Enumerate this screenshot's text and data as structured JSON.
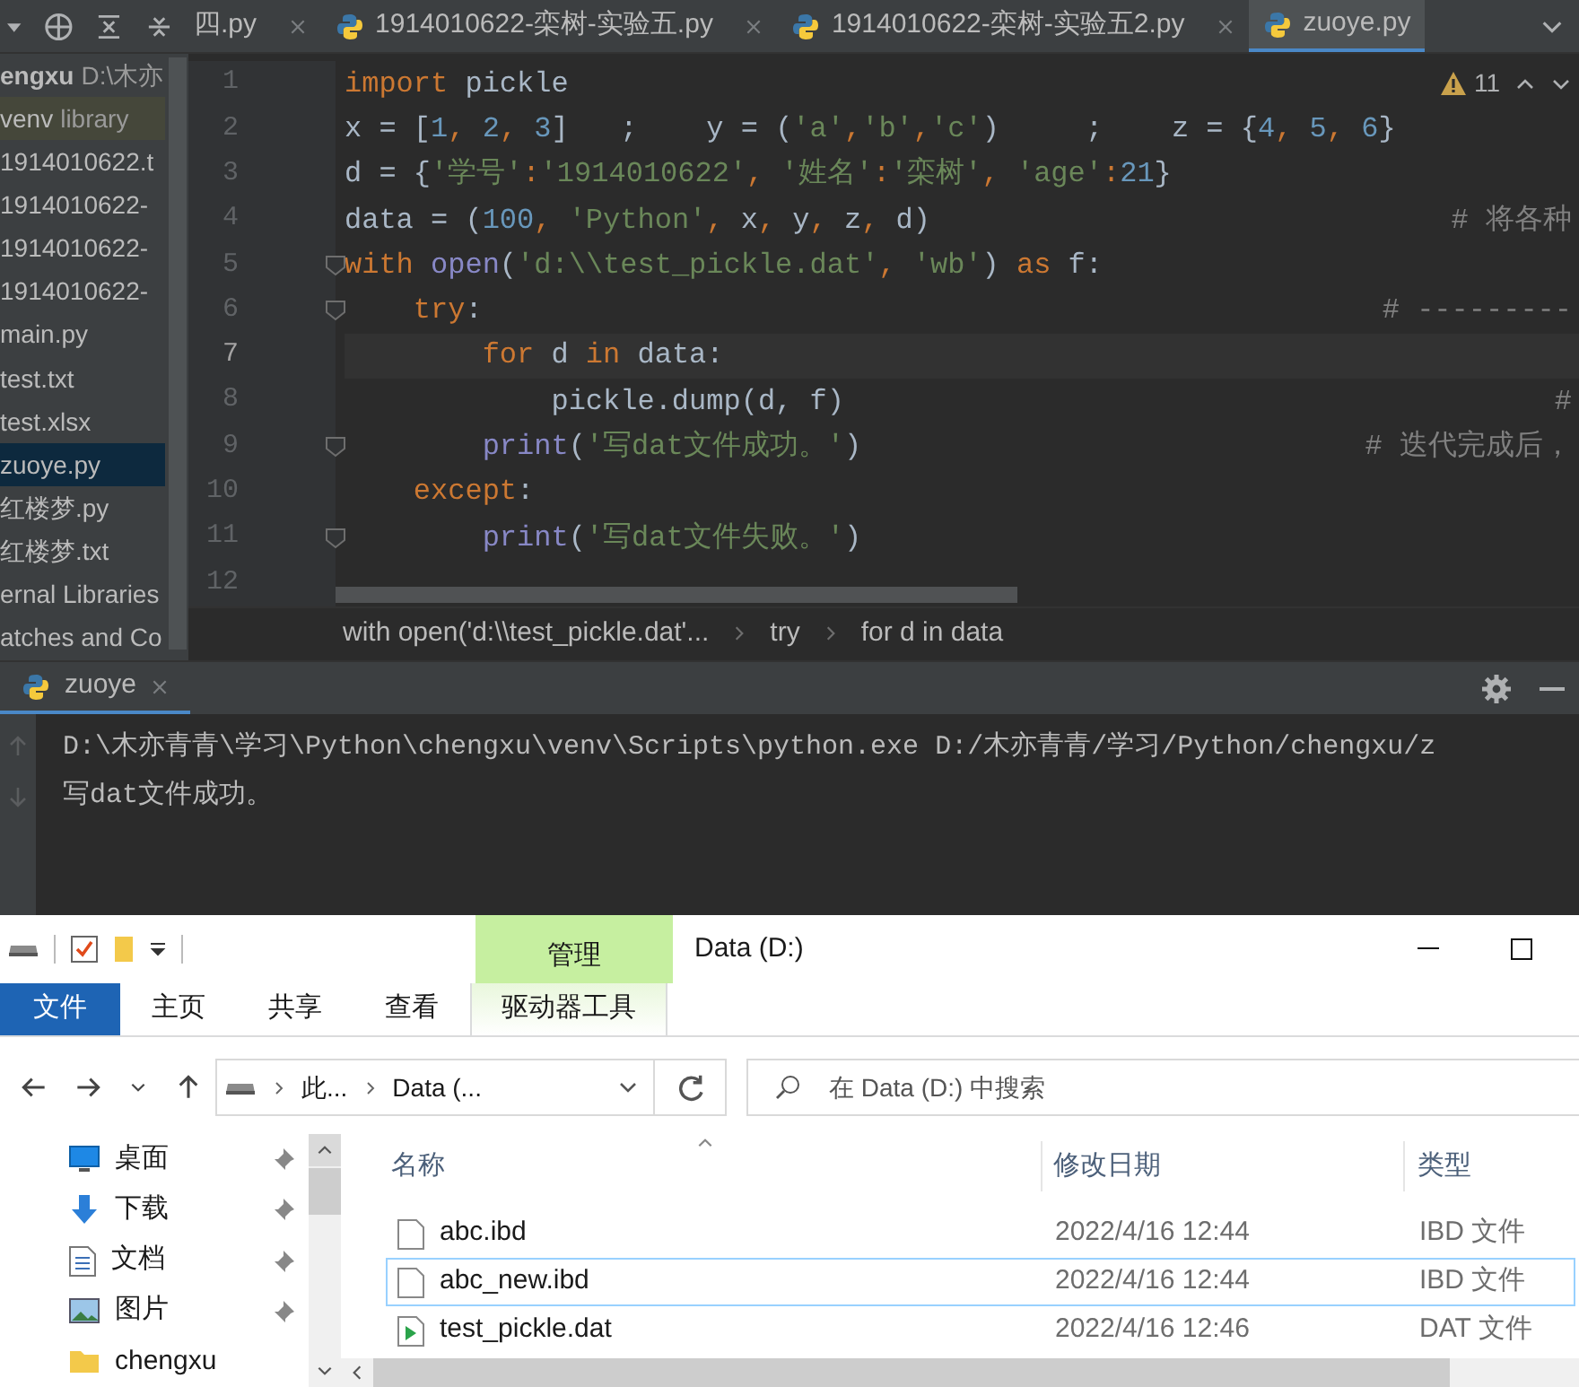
{
  "ide": {
    "tabs": [
      {
        "label": "四.py",
        "selected": false
      },
      {
        "label": "1914010622-栾树-实验五.py",
        "selected": false
      },
      {
        "label": "1914010622-栾树-实验五2.py",
        "selected": false
      },
      {
        "label": "zuoye.py",
        "selected": true
      }
    ],
    "project": {
      "items": [
        {
          "name": "engxu",
          "hint": "D:\\木亦",
          "selected": false,
          "kind": "root"
        },
        {
          "name": "venv",
          "hint": "library",
          "selected": false,
          "kind": "folder"
        },
        {
          "name": "1914010622.t",
          "selected": false,
          "kind": "file"
        },
        {
          "name": "1914010622-",
          "selected": false,
          "kind": "file"
        },
        {
          "name": "1914010622-",
          "selected": false,
          "kind": "file"
        },
        {
          "name": "1914010622-",
          "selected": false,
          "kind": "file"
        },
        {
          "name": "main.py",
          "selected": false,
          "kind": "file"
        },
        {
          "name": "test.txt",
          "selected": false,
          "kind": "file"
        },
        {
          "name": "test.xlsx",
          "selected": false,
          "kind": "file"
        },
        {
          "name": "zuoye.py",
          "selected": true,
          "kind": "file"
        },
        {
          "name": "红楼梦.py",
          "selected": false,
          "kind": "file"
        },
        {
          "name": "红楼梦.txt",
          "selected": false,
          "kind": "file"
        },
        {
          "name": "ernal Libraries",
          "selected": false,
          "kind": "file"
        },
        {
          "name": "atches and Co",
          "selected": false,
          "kind": "file"
        }
      ]
    },
    "editor": {
      "warnings": "11",
      "lines": [
        {
          "number": "1",
          "current": false,
          "fold": false,
          "tokens": [
            {
              "text": "import",
              "kind": "keyword"
            },
            {
              "text": " pickle",
              "kind": "plain"
            }
          ]
        },
        {
          "number": "2",
          "current": false,
          "fold": false,
          "tokens": [
            {
              "text": "x = [",
              "kind": "plain"
            },
            {
              "text": "1",
              "kind": "number"
            },
            {
              "text": ", ",
              "kind": "keyword"
            },
            {
              "text": "2",
              "kind": "number"
            },
            {
              "text": ", ",
              "kind": "keyword"
            },
            {
              "text": "3",
              "kind": "number"
            },
            {
              "text": "]   ;    y = (",
              "kind": "plain"
            },
            {
              "text": "'a'",
              "kind": "string"
            },
            {
              "text": ",",
              "kind": "keyword"
            },
            {
              "text": "'b'",
              "kind": "string"
            },
            {
              "text": ",",
              "kind": "keyword"
            },
            {
              "text": "'c'",
              "kind": "string"
            },
            {
              "text": ")     ;    z = {",
              "kind": "plain"
            },
            {
              "text": "4",
              "kind": "number"
            },
            {
              "text": ", ",
              "kind": "keyword"
            },
            {
              "text": "5",
              "kind": "number"
            },
            {
              "text": ", ",
              "kind": "keyword"
            },
            {
              "text": "6",
              "kind": "number"
            },
            {
              "text": "}",
              "kind": "plain"
            }
          ]
        },
        {
          "number": "3",
          "current": false,
          "fold": false,
          "tokens": [
            {
              "text": "d = {",
              "kind": "plain"
            },
            {
              "text": "'学号'",
              "kind": "string"
            },
            {
              "text": ":",
              "kind": "keyword"
            },
            {
              "text": "'1914010622'",
              "kind": "string"
            },
            {
              "text": ", ",
              "kind": "keyword"
            },
            {
              "text": "'姓名'",
              "kind": "string"
            },
            {
              "text": ":",
              "kind": "keyword"
            },
            {
              "text": "'栾树'",
              "kind": "string"
            },
            {
              "text": ", ",
              "kind": "keyword"
            },
            {
              "text": "'age'",
              "kind": "string"
            },
            {
              "text": ":",
              "kind": "keyword"
            },
            {
              "text": "21",
              "kind": "number"
            },
            {
              "text": "}",
              "kind": "plain"
            }
          ]
        },
        {
          "number": "4",
          "current": false,
          "fold": false,
          "comment": "# 将各种",
          "tokens": [
            {
              "text": "data = (",
              "kind": "plain"
            },
            {
              "text": "100",
              "kind": "number"
            },
            {
              "text": ", ",
              "kind": "keyword"
            },
            {
              "text": "'Python'",
              "kind": "string"
            },
            {
              "text": ", ",
              "kind": "keyword"
            },
            {
              "text": "x",
              "kind": "plain"
            },
            {
              "text": ", ",
              "kind": "keyword"
            },
            {
              "text": "y",
              "kind": "plain"
            },
            {
              "text": ", ",
              "kind": "keyword"
            },
            {
              "text": "z",
              "kind": "plain"
            },
            {
              "text": ", ",
              "kind": "keyword"
            },
            {
              "text": "d)",
              "kind": "plain"
            }
          ]
        },
        {
          "number": "5",
          "current": false,
          "fold": true,
          "tokens": [
            {
              "text": "with ",
              "kind": "keyword"
            },
            {
              "text": "open",
              "kind": "builtin"
            },
            {
              "text": "(",
              "kind": "plain"
            },
            {
              "text": "'d:\\\\test_pickle.dat'",
              "kind": "string"
            },
            {
              "text": ", ",
              "kind": "keyword"
            },
            {
              "text": "'wb'",
              "kind": "string"
            },
            {
              "text": ") ",
              "kind": "plain"
            },
            {
              "text": "as ",
              "kind": "keyword"
            },
            {
              "text": "f:",
              "kind": "plain"
            }
          ]
        },
        {
          "number": "6",
          "current": false,
          "fold": true,
          "comment": "# ---------",
          "tokens": [
            {
              "text": "    try",
              "kind": "keyword"
            },
            {
              "text": ":",
              "kind": "plain"
            }
          ]
        },
        {
          "number": "7",
          "current": true,
          "fold": false,
          "tokens": [
            {
              "text": "        for ",
              "kind": "keyword"
            },
            {
              "text": "d ",
              "kind": "plain"
            },
            {
              "text": "in ",
              "kind": "keyword"
            },
            {
              "text": "data:",
              "kind": "plain"
            }
          ]
        },
        {
          "number": "8",
          "current": false,
          "fold": false,
          "comment": "#",
          "tokens": [
            {
              "text": "            pickle.dump(d, f)",
              "kind": "plain"
            }
          ]
        },
        {
          "number": "9",
          "current": false,
          "fold": true,
          "comment": "# 迭代完成后，",
          "tokens": [
            {
              "text": "        print",
              "kind": "builtin"
            },
            {
              "text": "(",
              "kind": "plain"
            },
            {
              "text": "'写dat文件成功。'",
              "kind": "string"
            },
            {
              "text": ")",
              "kind": "plain"
            }
          ]
        },
        {
          "number": "10",
          "current": false,
          "fold": false,
          "tokens": [
            {
              "text": "    except",
              "kind": "keyword"
            },
            {
              "text": ":",
              "kind": "plain"
            }
          ]
        },
        {
          "number": "11",
          "current": false,
          "fold": true,
          "tokens": [
            {
              "text": "        print",
              "kind": "builtin"
            },
            {
              "text": "(",
              "kind": "plain"
            },
            {
              "text": "'写dat文件失败。'",
              "kind": "string"
            },
            {
              "text": ")",
              "kind": "plain"
            }
          ]
        },
        {
          "number": "12",
          "current": false,
          "fold": false
        }
      ],
      "breadcrumbs": [
        "with open('d:\\\\test_pickle.dat'...",
        "try",
        "for d in data"
      ]
    },
    "run": {
      "tab": "zuoye",
      "output": [
        "D:\\木亦青青\\学习\\Python\\chengxu\\venv\\Scripts\\python.exe D:/木亦青青/学习/Python/chengxu/z",
        "写dat文件成功。"
      ]
    }
  },
  "explorer": {
    "context_tab": "管理",
    "title": "Data (D:)",
    "ribbon_tabs": [
      {
        "label": "文件",
        "selected": true,
        "kind": "file"
      },
      {
        "label": "主页",
        "selected": false,
        "kind": "normal"
      },
      {
        "label": "共享",
        "selected": false,
        "kind": "normal"
      },
      {
        "label": "查看",
        "selected": false,
        "kind": "normal"
      },
      {
        "label": "驱动器工具",
        "selected": false,
        "kind": "context"
      }
    ],
    "address": [
      "此...",
      "Data (..."
    ],
    "search": {
      "placeholder": "在 Data (D:) 中搜索"
    },
    "nav": [
      {
        "label": "桌面",
        "kind": "desktop",
        "pinned": true
      },
      {
        "label": "下载",
        "kind": "download",
        "pinned": true
      },
      {
        "label": "文档",
        "kind": "document",
        "pinned": true
      },
      {
        "label": "图片",
        "kind": "image",
        "pinned": true
      },
      {
        "label": "chengxu",
        "kind": "folder",
        "pinned": false
      }
    ],
    "columns": [
      "名称",
      "修改日期",
      "类型"
    ],
    "files": [
      {
        "name": "abc.ibd",
        "date": "2022/4/16 12:44",
        "type": "IBD 文件",
        "kind": "blank",
        "selected": false
      },
      {
        "name": "abc_new.ibd",
        "date": "2022/4/16 12:44",
        "type": "IBD 文件",
        "kind": "blank",
        "selected": true
      },
      {
        "name": "test_pickle.dat",
        "date": "2022/4/16 12:46",
        "type": "DAT 文件",
        "kind": "media",
        "selected": false
      }
    ]
  }
}
